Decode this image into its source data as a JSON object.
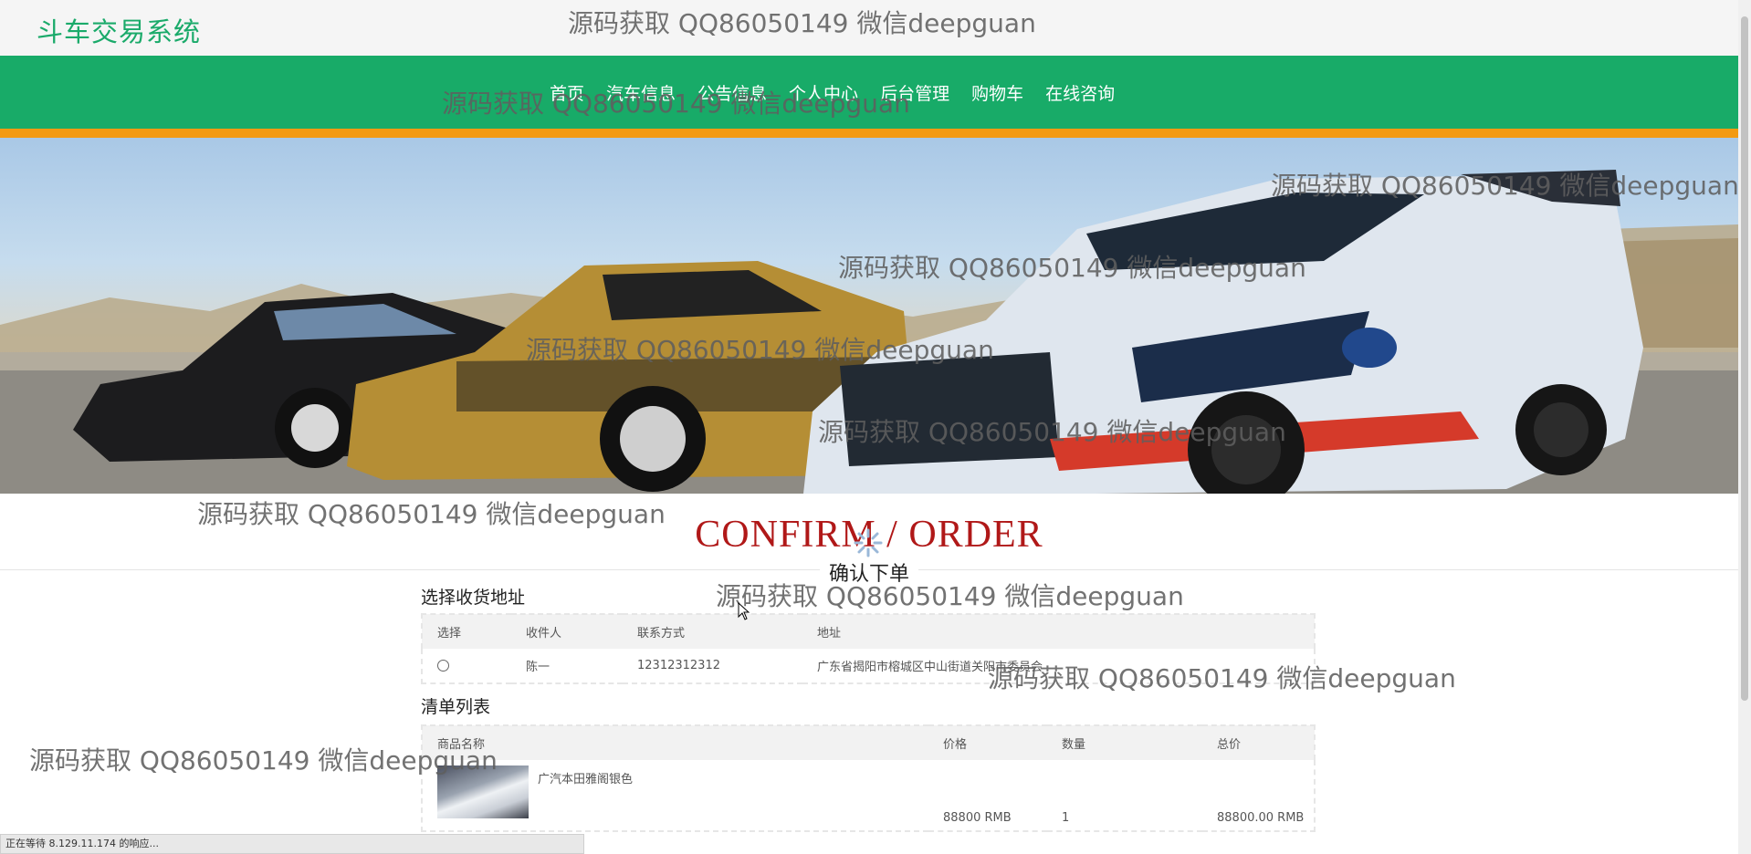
{
  "app": {
    "title": "斗车交易系统"
  },
  "nav": {
    "items": [
      "首页",
      "汽车信息",
      "公告信息",
      "个人中心",
      "后台管理",
      "购物车",
      "在线咨询"
    ]
  },
  "confirm": {
    "title": "CONFIRM / ORDER",
    "subtitle": "确认下单"
  },
  "address_section": {
    "title": "选择收货地址",
    "headers": [
      "选择",
      "收件人",
      "联系方式",
      "地址"
    ],
    "rows": [
      {
        "name": "陈一",
        "phone": "12312312312",
        "address": "广东省揭阳市榕城区中山街道关阳市委员会"
      }
    ]
  },
  "list_section": {
    "title": "清单列表",
    "headers": [
      "商品名称",
      "价格",
      "数量",
      "总价"
    ],
    "rows": [
      {
        "name": "广汽本田雅阁银色",
        "price": "88800 RMB",
        "quantity": "1",
        "total": "88800.00 RMB"
      }
    ]
  },
  "status_bar": {
    "text": "正在等待 8.129.11.174 的响应..."
  },
  "watermark": {
    "text": "源码获取 QQ86050149 微信deepguan"
  },
  "colors": {
    "brand_green": "#18ab68",
    "accent_orange": "#f39a12",
    "title_red": "#b01818"
  }
}
